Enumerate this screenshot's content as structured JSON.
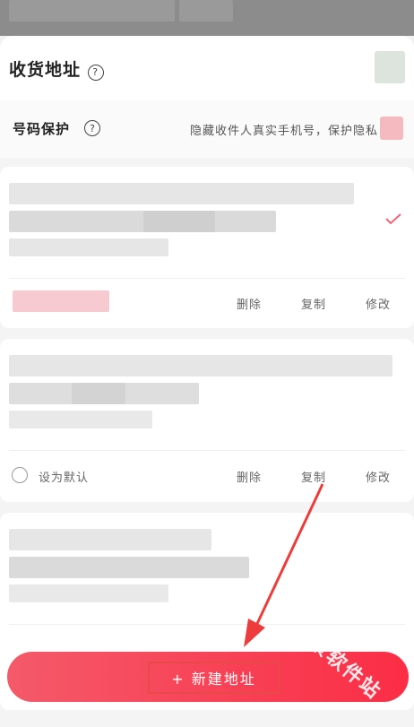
{
  "header": {
    "title": "收货地址",
    "help_glyph": "?"
  },
  "privacy": {
    "label": "号码保护",
    "help_glyph": "?",
    "description": "隐藏收件人真实手机号，保护隐私"
  },
  "addresses": [
    {
      "is_default": true,
      "actions": {
        "delete": "删除",
        "copy": "复制",
        "edit": "修改"
      }
    },
    {
      "is_default": false,
      "default_label": "设为默认",
      "actions": {
        "delete": "删除",
        "copy": "复制",
        "edit": "修改"
      }
    },
    {
      "is_default": false
    }
  ],
  "footer": {
    "add_button": "+ 新建地址"
  },
  "watermark": "景软件站",
  "colors": {
    "accent": "#fb2d45",
    "check": "#f2647a",
    "annotation_arrow": "#ee3b3b"
  }
}
